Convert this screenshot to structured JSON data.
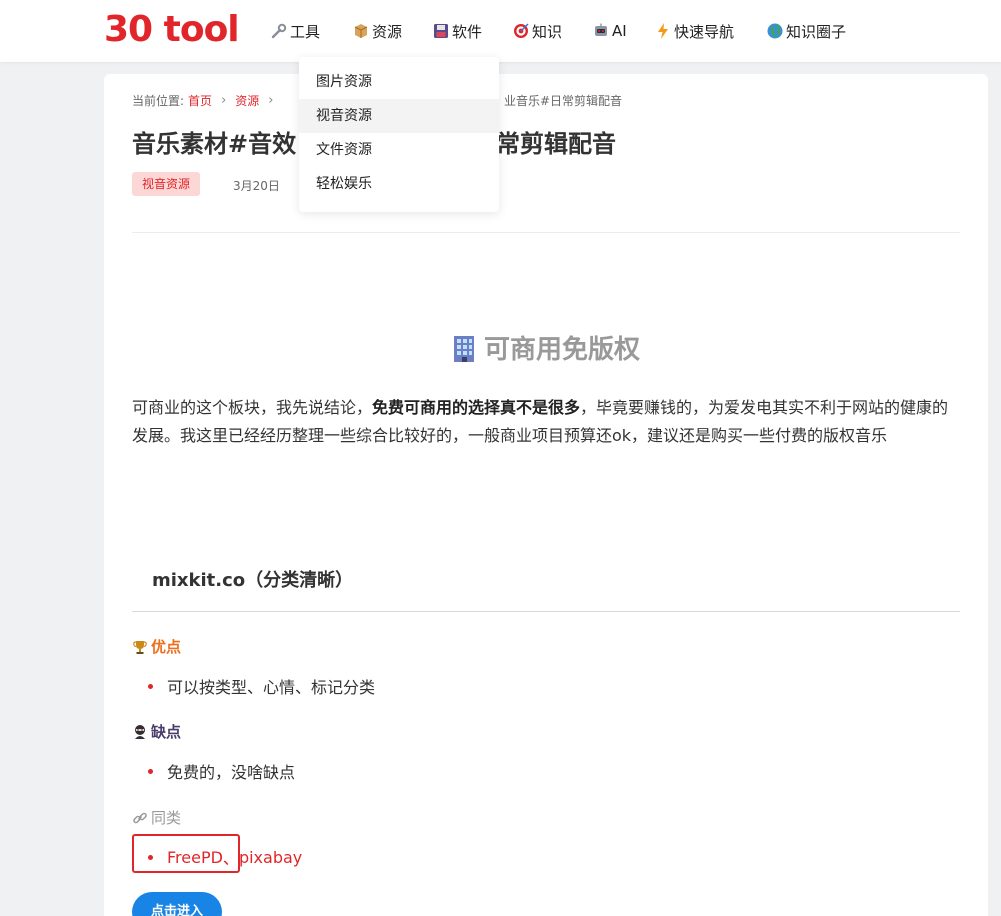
{
  "logo": {
    "text": "30 tool",
    "color": "#e0262b"
  },
  "nav": {
    "items": [
      {
        "label": "工具",
        "icon": "wrench-icon"
      },
      {
        "label": "资源",
        "icon": "package-icon"
      },
      {
        "label": "软件",
        "icon": "floppy-disk-icon"
      },
      {
        "label": "知识",
        "icon": "target-icon"
      },
      {
        "label": "AI",
        "icon": "robot-icon"
      },
      {
        "label": "快速导航",
        "icon": "lightning-icon"
      },
      {
        "label": "知识圈子",
        "icon": "globe-icon"
      }
    ]
  },
  "dropdown": {
    "items": [
      {
        "label": "图片资源"
      },
      {
        "label": "视音资源"
      },
      {
        "label": "文件资源"
      },
      {
        "label": "轻松娱乐"
      }
    ],
    "active_label": "视音资源"
  },
  "breadcrumb": {
    "prefix": "当前位置:",
    "home": "首页",
    "resources": "资源",
    "current_visible": "业音乐#日常剪辑配音"
  },
  "article": {
    "title_part1": "音乐素材#音效",
    "title_part2": "常剪辑配音",
    "tag": "视音资源",
    "date": "3月20日",
    "section_heading": "可商用免版权",
    "body_pre": "可商业的这个板块，我先说结论，",
    "body_bold": "免费可商用的选择真不是很多",
    "body_post": "，毕竟要赚钱的，为爱发电其实不利于网站的健康的发展。我这里已经经历整理一些综合比较好的，一般商业项目预算还ok，建议还是购买一些付费的版权音乐",
    "sub_heading": "mixkit.co（分类清晰）",
    "pros_label": "优点",
    "pros_item": "可以按类型、心情、标记分类",
    "cons_label": "缺点",
    "cons_item": "免费的，没啥缺点",
    "similar_label": "同类",
    "similar_link1": "FreePD",
    "similar_sep": "、",
    "similar_link2": "pixabay",
    "enter_button": "点击进入"
  },
  "colors": {
    "brand_red": "#e0262b",
    "button_blue": "#1784e6",
    "pros_orange": "#ec6f1e",
    "cons_purple": "#4a3c6b"
  }
}
